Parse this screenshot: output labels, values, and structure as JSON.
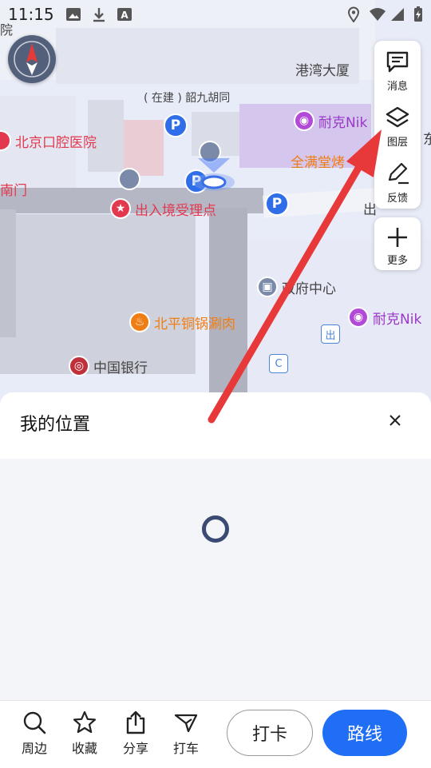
{
  "status_bar": {
    "time": "11:15",
    "left_icons": [
      "image-icon",
      "download-icon",
      "font-icon"
    ],
    "right_icons": [
      "location-icon",
      "wifi-icon",
      "signal-icon",
      "battery-icon"
    ]
  },
  "map": {
    "top_left_partial_text": "院",
    "pois": {
      "gangwan": "港湾大厦",
      "building_note": "( 在建 ) 韶九胡同",
      "dental": "北京口腔医院",
      "nike_top": "耐克Nik",
      "roast": "全满堂烤",
      "south_gate": "南门",
      "immigration": "出入境受理点",
      "exit_top": "出",
      "east_partial": "东",
      "gov_center": "政府中心",
      "hotpot": "北平铜锅涮肉",
      "nike_bottom": "耐克Nik",
      "bank": "中国银行",
      "exit_sign": "出",
      "c_sign": "C",
      "parking": "P"
    },
    "toolbar": [
      {
        "label": "消息",
        "icon": "message-icon"
      },
      {
        "label": "图层",
        "icon": "layers-icon"
      },
      {
        "label": "反馈",
        "icon": "feedback-pen-icon"
      }
    ],
    "more": {
      "label": "更多",
      "icon": "plus-icon"
    },
    "compass_icon": "compass-icon"
  },
  "sheet": {
    "title": "我的位置",
    "close_icon": "close-icon",
    "loading_icon": "loading-spinner-icon"
  },
  "bottom_nav": {
    "items": [
      {
        "label": "周边",
        "icon": "search-icon"
      },
      {
        "label": "收藏",
        "icon": "star-icon"
      },
      {
        "label": "分享",
        "icon": "share-icon"
      },
      {
        "label": "打车",
        "icon": "taxi-icon"
      }
    ],
    "checkin_label": "打卡",
    "route_label": "路线"
  },
  "colors": {
    "route_button": "#1f6ef5",
    "annotation_arrow": "#e8393a",
    "poi_red": "#e2394f",
    "poi_orange": "#f07d14",
    "poi_purple": "#9b38c8"
  }
}
